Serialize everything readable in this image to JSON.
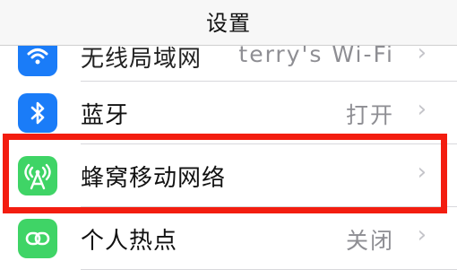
{
  "nav": {
    "title": "设置"
  },
  "colors": {
    "accent_blue": "#1a7cf8",
    "wifi_blue": "#1a7cf8",
    "cellular_green": "#3fd466",
    "hotspot_green": "#3fd466",
    "highlight_red": "#f31d10"
  },
  "rows": {
    "wifi": {
      "label": "无线局域网",
      "value": "terry's Wi-Fi",
      "icon": "wifi-icon"
    },
    "bluetooth": {
      "label": "蓝牙",
      "value": "打开",
      "icon": "bluetooth-icon"
    },
    "cellular": {
      "label": "蜂窝移动网络",
      "value": "",
      "icon": "antenna-icon"
    },
    "hotspot": {
      "label": "个人热点",
      "value": "关闭",
      "icon": "hotspot-icon"
    }
  },
  "chevron": "›"
}
